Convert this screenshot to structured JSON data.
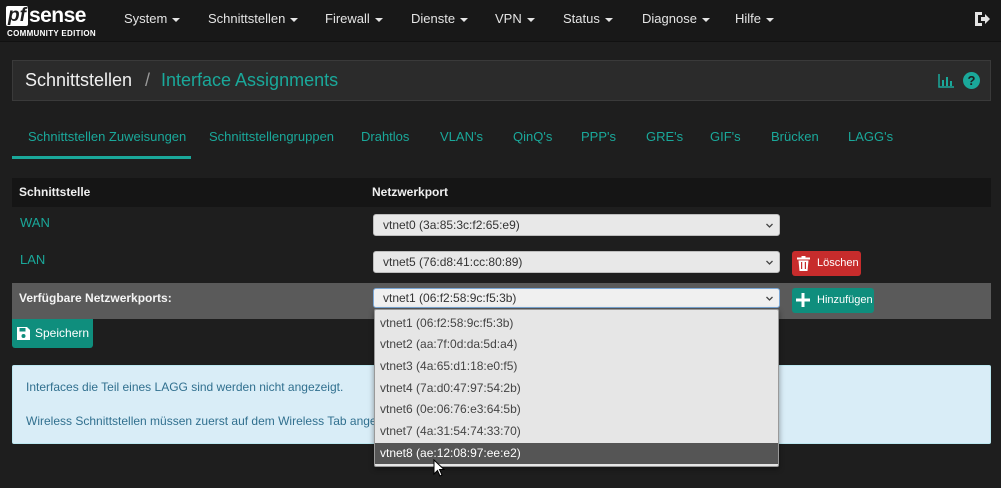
{
  "brand": {
    "pf": "pf",
    "sense": "sense",
    "edition": "COMMUNITY EDITION"
  },
  "nav": {
    "items": [
      "System",
      "Schnittstellen",
      "Firewall",
      "Dienste",
      "VPN",
      "Status",
      "Diagnose",
      "Hilfe"
    ],
    "logout_icon": "sign-out-icon"
  },
  "breadcrumb": {
    "section": "Schnittstellen",
    "separator": "/",
    "page": "Interface Assignments"
  },
  "header_icons": {
    "chart": "bar-chart-icon",
    "help": "?"
  },
  "tabs": [
    "Schnittstellen Zuweisungen",
    "Schnittstellengruppen",
    "Drahtlos",
    "VLAN's",
    "QinQ's",
    "PPP's",
    "GRE's",
    "GIF's",
    "Brücken",
    "LAGG's"
  ],
  "active_tab": "Schnittstellen Zuweisungen",
  "table": {
    "headers": {
      "interface": "Schnittstelle",
      "port": "Netzwerkport"
    },
    "rows": [
      {
        "name": "WAN",
        "port": "vtnet0 (3a:85:3c:f2:65:e9)"
      },
      {
        "name": "LAN",
        "port": "vtnet5 (76:d8:41:cc:80:89)",
        "delete_label": "Löschen"
      }
    ],
    "available": {
      "label": "Verfügbare Netzwerkports:",
      "selected": "vtnet1 (06:f2:58:9c:f5:3b)",
      "add_label": "Hinzufügen"
    }
  },
  "save_label": "Speichern",
  "info": {
    "line1": "Interfaces die Teil eines LAGG sind werden nicht angezeigt.",
    "line2": "Wireless Schnittstellen müssen zuerst auf dem Wireless Tab ange"
  },
  "dropdown": {
    "options": [
      "vtnet1 (06:f2:58:9c:f5:3b)",
      "vtnet2 (aa:7f:0d:da:5d:a4)",
      "vtnet3 (4a:65:d1:18:e0:f5)",
      "vtnet4 (7a:d0:47:97:54:2b)",
      "vtnet6 (0e:06:76:e3:64:5b)",
      "vtnet7 (4a:31:54:74:33:70)",
      "vtnet8 (ae:12:08:97:ee:e2)"
    ],
    "highlighted": "vtnet8 (ae:12:08:97:ee:e2)"
  },
  "colors": {
    "accent": "#1aa89a",
    "danger": "#c72c2c",
    "success": "#0f8e7d",
    "info_bg": "#d9edf7",
    "info_text": "#31708f"
  }
}
